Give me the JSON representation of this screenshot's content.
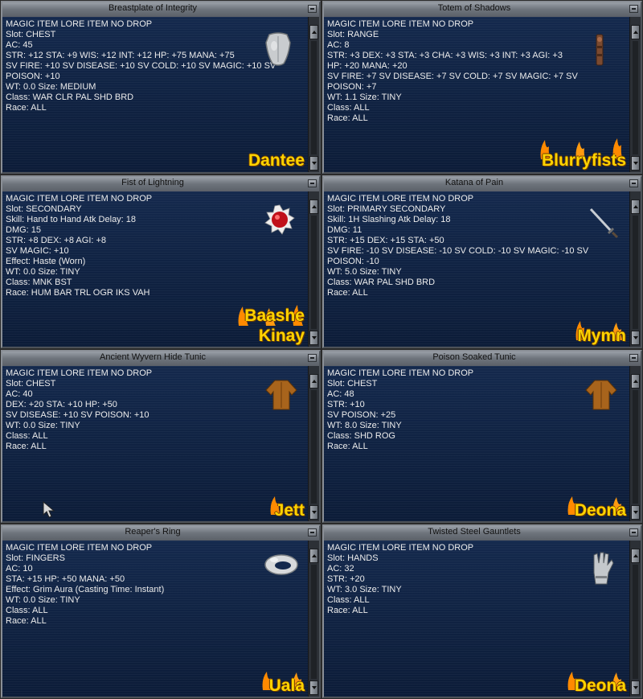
{
  "windows": [
    {
      "title": "Breastplate of Integrity",
      "icon": "breastplate-icon",
      "lines": [
        "MAGIC ITEM LORE ITEM NO DROP",
        "Slot: CHEST",
        "AC: 45",
        "STR: +12 STA: +9 WIS: +12 INT: +12 HP: +75 MANA: +75",
        "SV FIRE: +10 SV DISEASE: +10 SV COLD: +10 SV MAGIC: +10 SV",
        "POISON: +10",
        "WT: 0.0 Size: MEDIUM",
        "Class: WAR CLR PAL SHD BRD",
        "Race: ALL"
      ],
      "names": [
        "Dantee"
      ]
    },
    {
      "title": "Totem of Shadows",
      "icon": "totem-icon",
      "lines": [
        "MAGIC ITEM LORE ITEM NO DROP",
        "Slot: RANGE",
        "AC: 8",
        "STR: +3 DEX: +3 STA: +3 CHA: +3 WIS: +3 INT: +3 AGI: +3",
        "HP: +20 MANA: +20",
        "SV FIRE: +7 SV DISEASE: +7 SV COLD: +7 SV MAGIC: +7 SV",
        "POISON: +7",
        "WT: 1.1 Size: TINY",
        "Class: ALL",
        "Race: ALL"
      ],
      "names": [
        "Blurryfists"
      ]
    },
    {
      "title": "Fist of Lightning",
      "icon": "red-gem-icon",
      "lines": [
        "MAGIC ITEM LORE ITEM NO DROP",
        "Slot: SECONDARY",
        "Skill: Hand to Hand Atk Delay: 18",
        "DMG: 15",
        "STR: +8 DEX: +8 AGI: +8",
        "SV MAGIC: +10",
        "Effect: Haste (Worn)",
        "WT: 0.0 Size: TINY",
        "Class: MNK BST",
        "Race: HUM BAR TRL OGR IKS VAH"
      ],
      "names": [
        "Baashe",
        "Kinay"
      ]
    },
    {
      "title": "Katana of Pain",
      "icon": "katana-icon",
      "lines": [
        "MAGIC ITEM LORE ITEM NO DROP",
        "Slot: PRIMARY SECONDARY",
        "Skill: 1H Slashing Atk Delay: 18",
        "DMG: 11",
        "STR: +15 DEX: +15 STA: +50",
        "SV FIRE: -10 SV DISEASE: -10 SV COLD: -10 SV MAGIC: -10 SV",
        "POISON: -10",
        "WT: 5.0 Size: TINY",
        "Class: WAR PAL SHD BRD",
        "Race: ALL"
      ],
      "names": [
        "Mymn"
      ]
    },
    {
      "title": "Ancient Wyvern Hide Tunic",
      "icon": "tunic-icon",
      "lines": [
        "MAGIC ITEM LORE ITEM NO DROP",
        "Slot: CHEST",
        "AC: 40",
        "DEX: +20 STA: +10 HP: +50",
        "SV DISEASE: +10 SV POISON: +10",
        "WT: 0.0 Size: TINY",
        "Class: ALL",
        "Race: ALL"
      ],
      "names": [
        "Jett"
      ]
    },
    {
      "title": "Poison Soaked Tunic",
      "icon": "tunic-icon",
      "lines": [
        "MAGIC ITEM LORE ITEM NO DROP",
        "Slot: CHEST",
        "AC: 48",
        "STR: +10",
        "SV POISON: +25",
        "WT: 8.0 Size: TINY",
        "Class: SHD ROG",
        "Race: ALL"
      ],
      "names": [
        "Deona"
      ]
    },
    {
      "title": "Reaper's Ring",
      "icon": "ring-icon",
      "lines": [
        "MAGIC ITEM LORE ITEM NO DROP",
        "Slot: FINGERS",
        "AC: 10",
        "STA: +15 HP: +50 MANA: +50",
        "Effect: Grim Aura (Casting Time: Instant)",
        "WT: 0.0 Size: TINY",
        "Class: ALL",
        "Race: ALL"
      ],
      "names": [
        "Uala"
      ]
    },
    {
      "title": "Twisted Steel Gauntlets",
      "icon": "gauntlets-icon",
      "lines": [
        "MAGIC ITEM LORE ITEM NO DROP",
        "Slot: HANDS",
        "AC: 32",
        "STR: +20",
        "WT: 3.0 Size: TINY",
        "Class: ALL",
        "Race: ALL"
      ],
      "names": [
        "Deona"
      ]
    }
  ]
}
